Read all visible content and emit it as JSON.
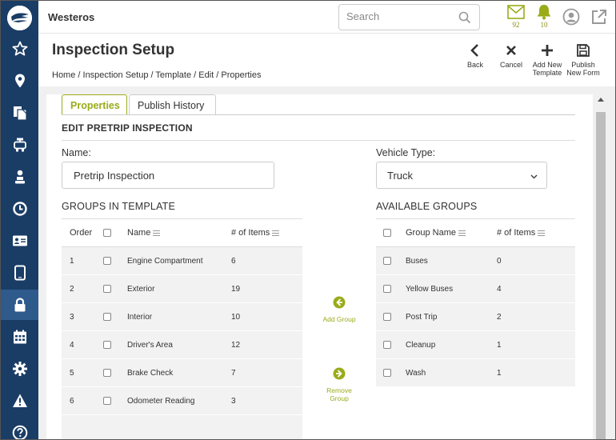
{
  "app": {
    "title": "Westeros"
  },
  "search": {
    "placeholder": "Search"
  },
  "notifications": {
    "mail_count": "92",
    "bell_count": "10"
  },
  "colors": {
    "sidebar": "#1a3d66",
    "accent": "#9aab1a",
    "active_sidebar": "#2e5a8c"
  },
  "sidebar": {
    "items": [
      {
        "icon": "star-icon"
      },
      {
        "icon": "map-pin-icon"
      },
      {
        "icon": "documents-icon"
      },
      {
        "icon": "engine-icon"
      },
      {
        "icon": "driver-icon"
      },
      {
        "icon": "clock-icon"
      },
      {
        "icon": "id-card-icon"
      },
      {
        "icon": "tablet-icon"
      },
      {
        "icon": "lock-icon",
        "active": true
      },
      {
        "icon": "calendar-icon"
      },
      {
        "icon": "gear-icon"
      },
      {
        "icon": "warning-icon"
      },
      {
        "icon": "help-icon"
      }
    ]
  },
  "page": {
    "title": "Inspection Setup",
    "breadcrumb": "Home / Inspection Setup / Template / Edit / Properties"
  },
  "toolbar": {
    "back": "Back",
    "cancel": "Cancel",
    "add_new_template_1": "Add New",
    "add_new_template_2": "Template",
    "publish_1": "Publish",
    "publish_2": "New Form"
  },
  "tabs": [
    {
      "label": "Properties",
      "active": true
    },
    {
      "label": "Publish History",
      "active": false
    }
  ],
  "form": {
    "section_title": "EDIT PRETRIP INSPECTION",
    "name_label": "Name:",
    "name_value": "Pretrip Inspection",
    "vehicle_type_label": "Vehicle Type:",
    "vehicle_type_value": "Truck"
  },
  "groups_in_template": {
    "title": "GROUPS IN TEMPLATE",
    "columns": {
      "order": "Order",
      "name": "Name",
      "items": "# of Items"
    },
    "rows": [
      {
        "order": "1",
        "name": "Engine Compartment",
        "items": "6"
      },
      {
        "order": "2",
        "name": "Exterior",
        "items": "19"
      },
      {
        "order": "3",
        "name": "Interior",
        "items": "10"
      },
      {
        "order": "4",
        "name": "Driver's Area",
        "items": "12"
      },
      {
        "order": "5",
        "name": "Brake Check",
        "items": "7"
      },
      {
        "order": "6",
        "name": "Odometer Reading",
        "items": "3"
      }
    ]
  },
  "available_groups": {
    "title": "AVAILABLE GROUPS",
    "columns": {
      "name": "Group Name",
      "items": "# of Items"
    },
    "rows": [
      {
        "name": "Buses",
        "items": "0"
      },
      {
        "name": "Yellow Buses",
        "items": "4"
      },
      {
        "name": "Post Trip",
        "items": "2"
      },
      {
        "name": "Cleanup",
        "items": "1"
      },
      {
        "name": "Wash",
        "items": "1"
      }
    ]
  },
  "actions": {
    "add_group": "Add Group",
    "remove_group_1": "Remove",
    "remove_group_2": "Group"
  }
}
